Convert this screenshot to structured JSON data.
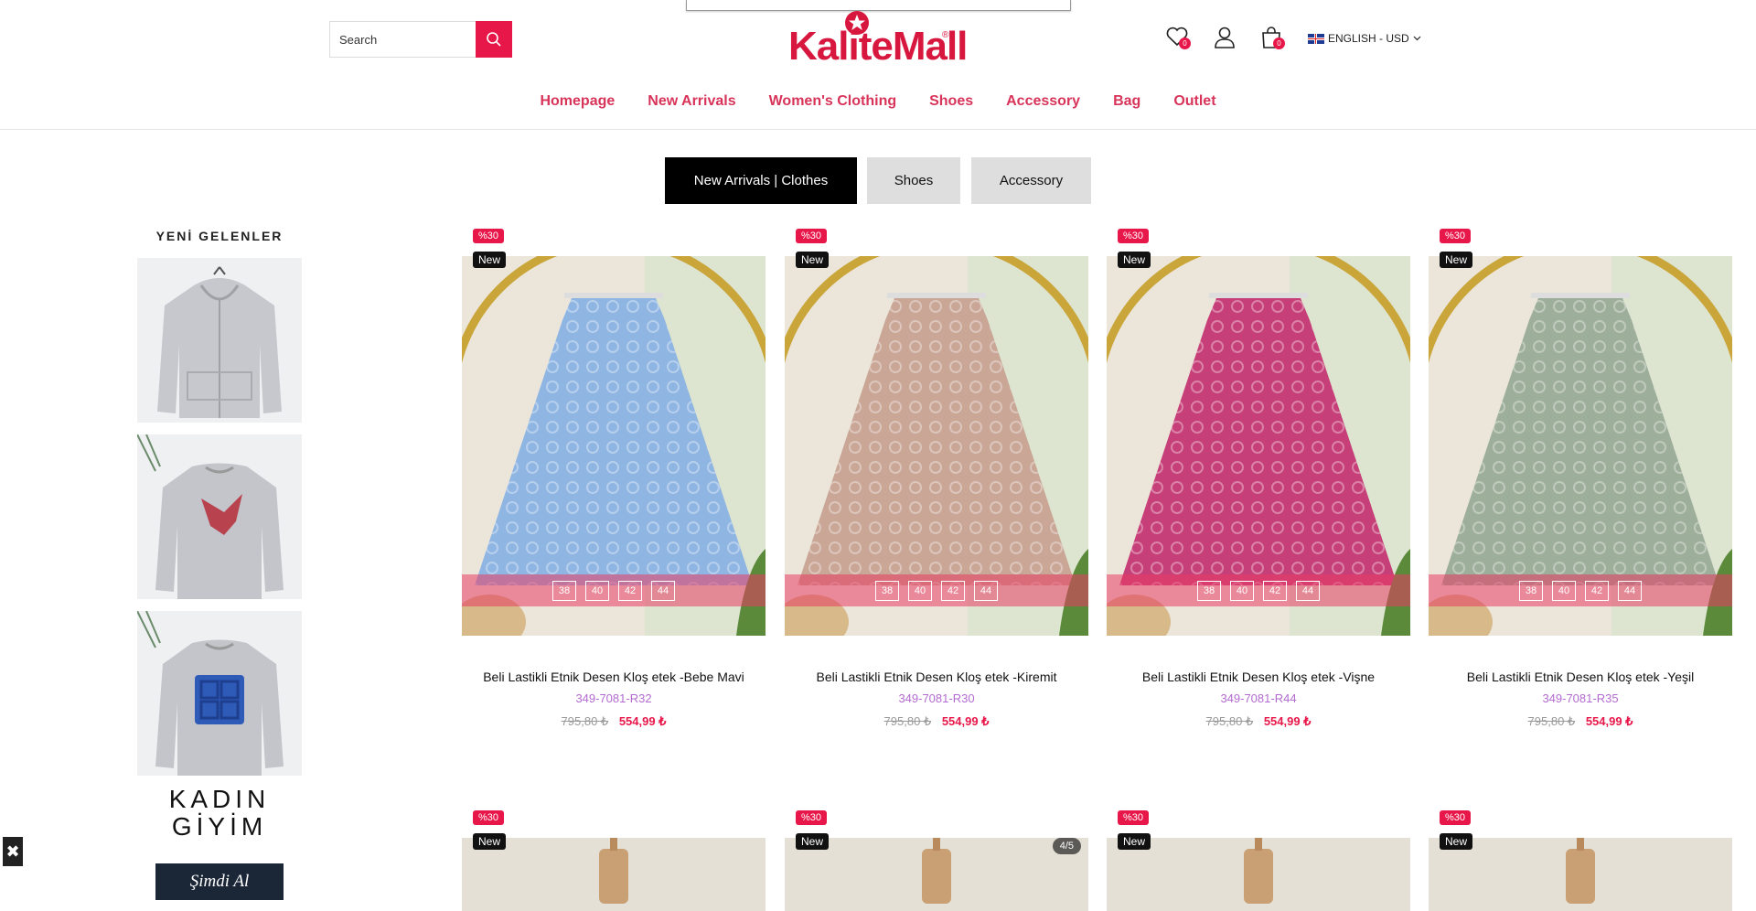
{
  "header": {
    "search_placeholder": "Search",
    "logo": "KaliteMall",
    "wishlist_count": "0",
    "cart_count": "0",
    "language": "ENGLISH - USD"
  },
  "nav": [
    "Homepage",
    "New Arrivals",
    "Women's Clothing",
    "Shoes",
    "Accessory",
    "Bag",
    "Outlet"
  ],
  "tabs": [
    "New Arrivals | Clothes",
    "Shoes",
    "Accessory"
  ],
  "sidebar": {
    "title": "YENİ GELENLER",
    "promo_line1": "KADIN",
    "promo_line2": "GİYİM",
    "cta": "Şimdi Al"
  },
  "products": [
    {
      "discount": "%30",
      "badge": "New",
      "name": "Beli Lastikli Etnik Desen Kloş etek -Bebe Mavi",
      "code": "349-7081-R32",
      "old_price": "795,80 ₺",
      "price": "554,99 ₺",
      "sizes": [
        "38",
        "40",
        "42",
        "44"
      ],
      "color": "#8fb5e3"
    },
    {
      "discount": "%30",
      "badge": "New",
      "name": "Beli Lastikli Etnik Desen Kloş etek -Kiremit",
      "code": "349-7081-R30",
      "old_price": "795,80 ₺",
      "price": "554,99 ₺",
      "sizes": [
        "38",
        "40",
        "42",
        "44"
      ],
      "color": "#c9a696"
    },
    {
      "discount": "%30",
      "badge": "New",
      "name": "Beli Lastikli Etnik Desen Kloş etek -Vişne",
      "code": "349-7081-R44",
      "old_price": "795,80 ₺",
      "price": "554,99 ₺",
      "sizes": [
        "38",
        "40",
        "42",
        "44"
      ],
      "color": "#c63f78"
    },
    {
      "discount": "%30",
      "badge": "New",
      "name": "Beli Lastikli Etnik Desen Kloş etek -Yeşil",
      "code": "349-7081-R35",
      "old_price": "795,80 ₺",
      "price": "554,99 ₺",
      "sizes": [
        "38",
        "40",
        "42",
        "44"
      ],
      "color": "#9dae9a"
    }
  ],
  "row2": [
    {
      "discount": "%30",
      "badge": "New"
    },
    {
      "discount": "%30",
      "badge": "New",
      "counter": "4/5"
    },
    {
      "discount": "%30",
      "badge": "New"
    },
    {
      "discount": "%30",
      "badge": "New"
    }
  ]
}
